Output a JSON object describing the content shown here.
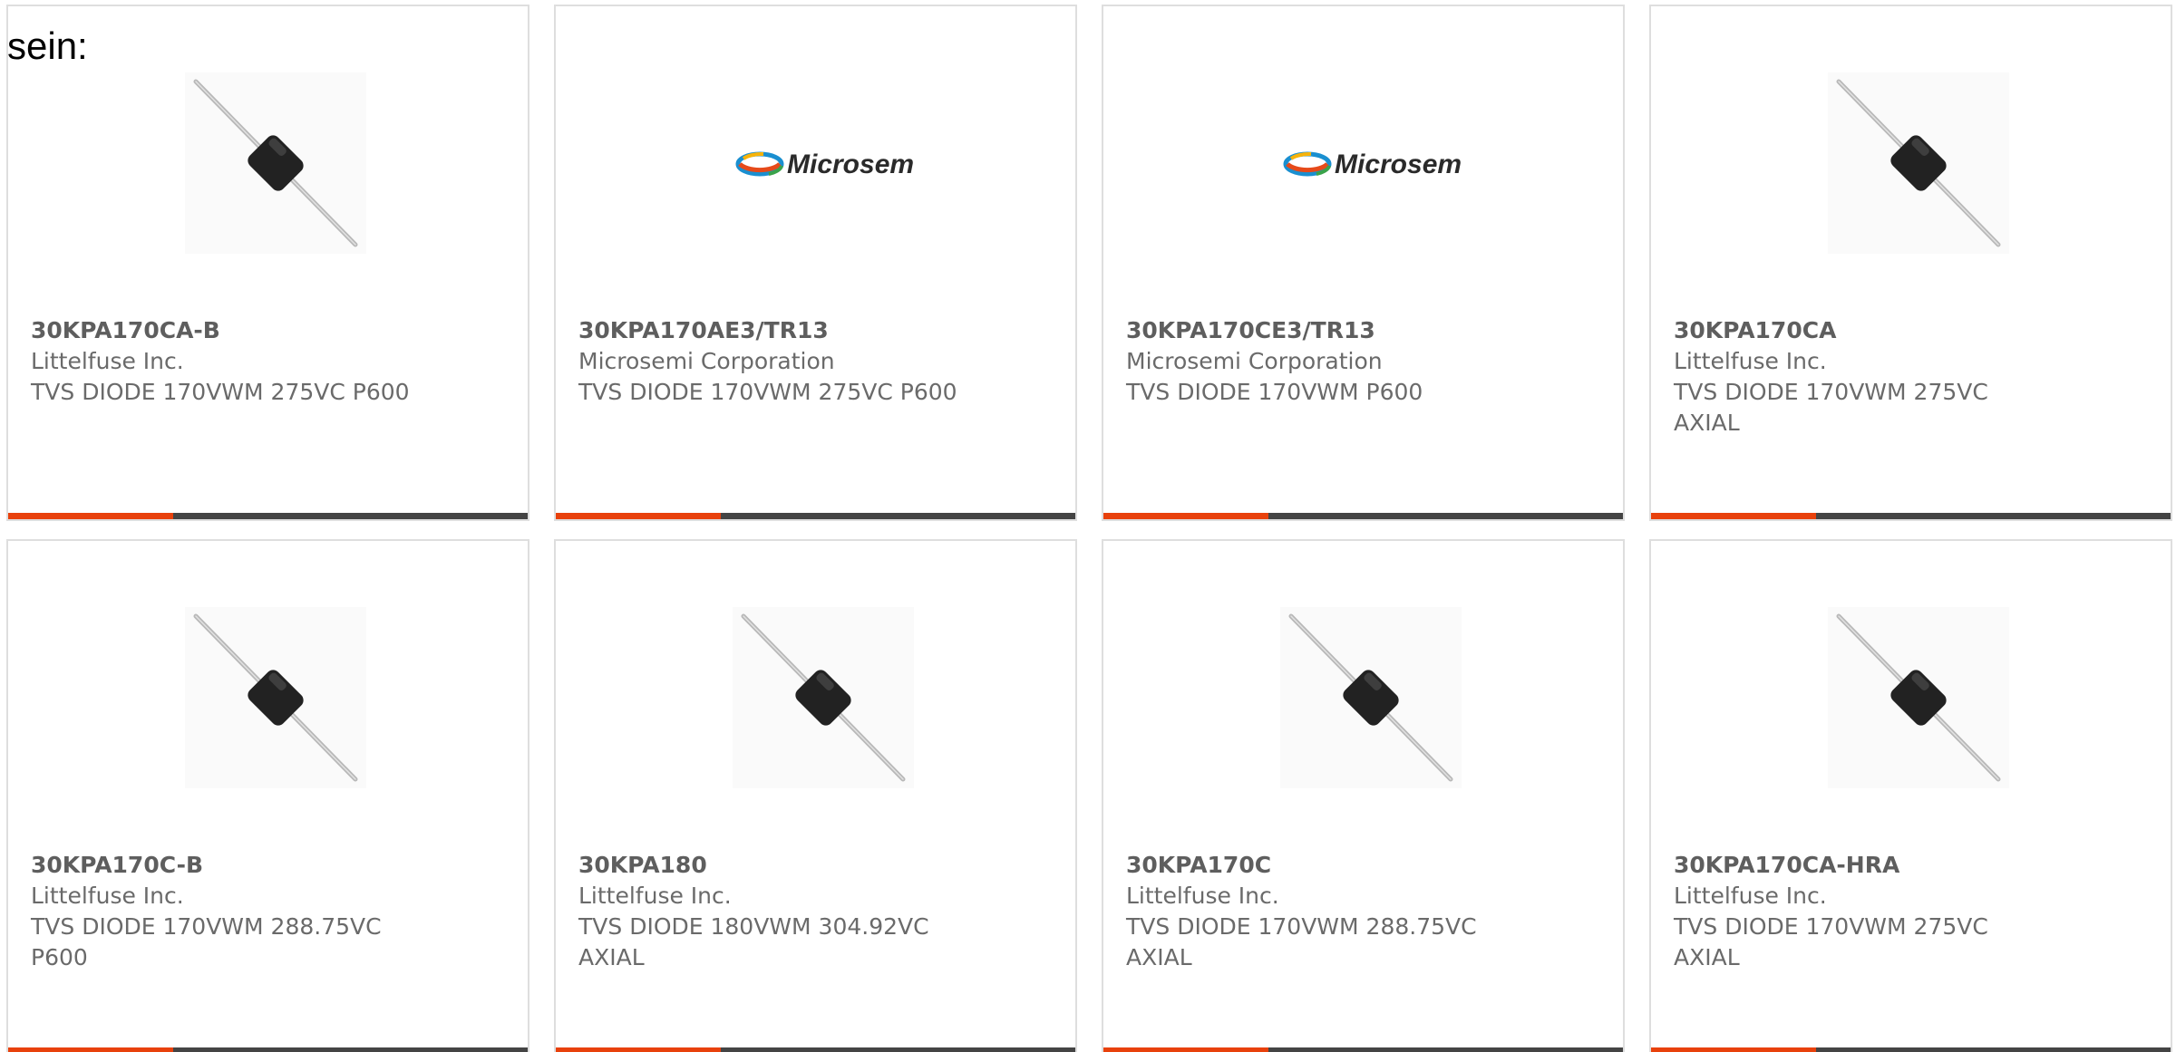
{
  "intro_text": "sein:",
  "colors": {
    "accent_bar": "#e8410c",
    "bar": "#444444",
    "card_border": "#dedede",
    "text": "#6a6a6a"
  },
  "products": [
    {
      "part_number": "30KPA170CA-B",
      "manufacturer": "Littelfuse Inc.",
      "description": "TVS DIODE 170VWM 275VC P600",
      "image": "diode-axial"
    },
    {
      "part_number": "30KPA170AE3/TR13",
      "manufacturer": "Microsemi Corporation",
      "description": "TVS DIODE 170VWM 275VC P600",
      "image": "microsemi-logo",
      "logo_text": "Microsemi"
    },
    {
      "part_number": "30KPA170CE3/TR13",
      "manufacturer": "Microsemi Corporation",
      "description": "TVS DIODE 170VWM P600",
      "image": "microsemi-logo",
      "logo_text": "Microsemi"
    },
    {
      "part_number": "30KPA170CA",
      "manufacturer": "Littelfuse Inc.",
      "description": "TVS DIODE 170VWM 275VC AXIAL",
      "image": "diode-axial"
    },
    {
      "part_number": "30KPA170C-B",
      "manufacturer": "Littelfuse Inc.",
      "description": "TVS DIODE 170VWM 288.75VC P600",
      "image": "diode-axial"
    },
    {
      "part_number": "30KPA180",
      "manufacturer": "Littelfuse Inc.",
      "description": "TVS DIODE 180VWM 304.92VC AXIAL",
      "image": "diode-axial"
    },
    {
      "part_number": "30KPA170C",
      "manufacturer": "Littelfuse Inc.",
      "description": "TVS DIODE 170VWM 288.75VC AXIAL",
      "image": "diode-axial"
    },
    {
      "part_number": "30KPA170CA-HRA",
      "manufacturer": "Littelfuse Inc.",
      "description": "TVS DIODE 170VWM 275VC AXIAL",
      "image": "diode-axial"
    }
  ]
}
